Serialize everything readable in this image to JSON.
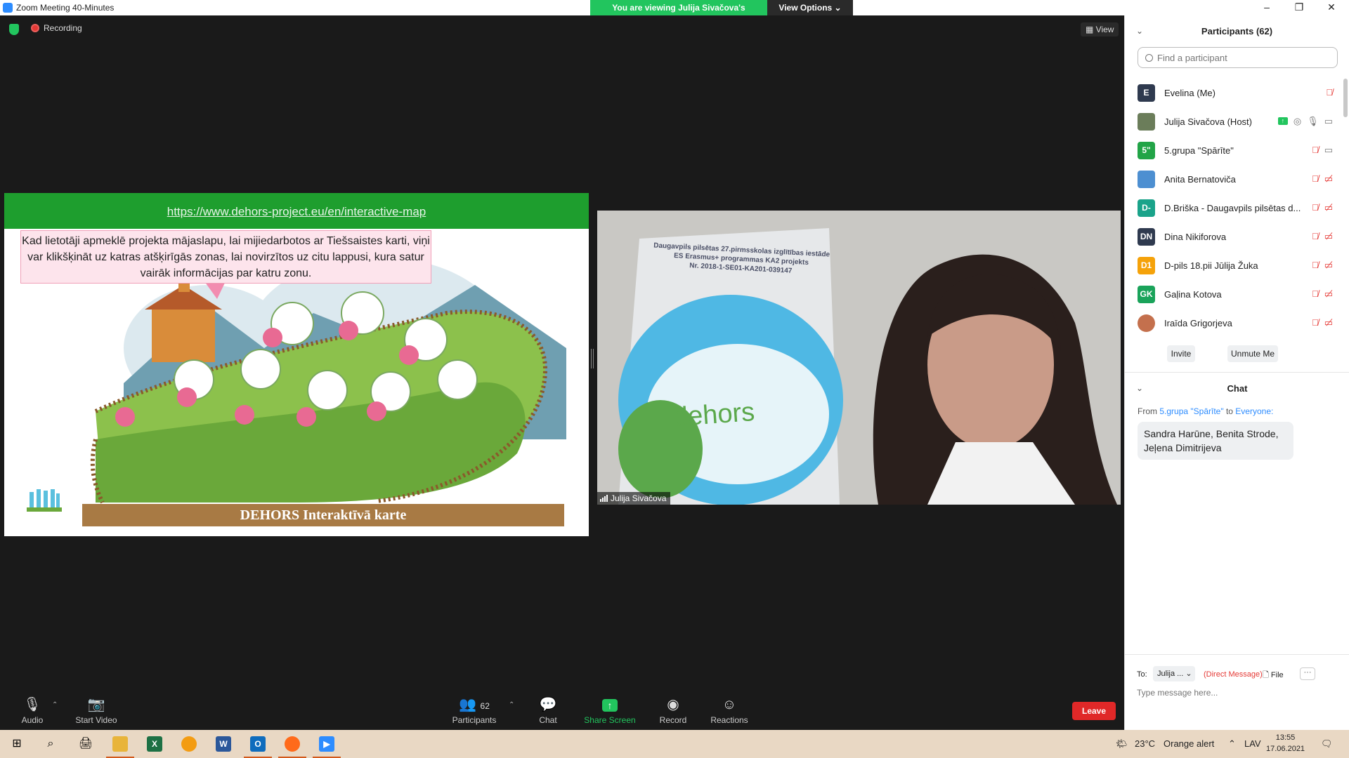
{
  "titlebar": {
    "title": "Zoom Meeting 40-Minutes",
    "minimize": "–",
    "maximize": "❐",
    "close": "✕"
  },
  "view_banner": {
    "message": "You are viewing Julija Sivačova's screen",
    "options": "View Options ⌄"
  },
  "meeting": {
    "recording_label": "Recording",
    "view_label": "▦ View"
  },
  "shared_screen": {
    "url": "https://www.dehors-project.eu/en/interactive-map",
    "callout": "Kad lietotāji apmeklē projekta mājaslapu, lai mijiedarbotos ar Tiešsaistes karti, viņi var klikšķināt uz katras atšķirīgās zonas, lai novirzītos uz citu lappusi, kura satur vairāk informācijas par katru zonu.",
    "banner": "DEHORS Interaktīvā karte"
  },
  "video": {
    "doc_lines": [
      "Daugavpils pilsētas 27.pirmsskolas izglītības iestāde",
      "ES Erasmus+ programmas KA2 projekts",
      "Nr. 2018-1-SE01-KA201-039147"
    ],
    "doc_logo": "dehors",
    "participant_name": "Julija Sivačova"
  },
  "toolbar": {
    "audio": "Audio",
    "start_video": "Start Video",
    "participants": "Participants",
    "participants_count": "62",
    "chat": "Chat",
    "share_screen": "Share Screen",
    "record": "Record",
    "reactions": "Reactions",
    "leave": "Leave"
  },
  "participants_panel": {
    "title": "Participants (62)",
    "search_placeholder": "Find a participant",
    "participants": [
      {
        "initials": "E",
        "name": "Evelina (Me)",
        "color": "#2f3a4f"
      },
      {
        "initials": "",
        "name": "Julija Sivačova (Host)",
        "color": "#6b7d5a"
      },
      {
        "initials": "5\"",
        "name": "5.grupa \"Spārīte\"",
        "color": "#22a447"
      },
      {
        "initials": "",
        "name": "Anita Bernatoviča",
        "color": "#4d8fd1"
      },
      {
        "initials": "D-",
        "name": "D.Briška - Daugavpils pilsētas d...",
        "color": "#1aa38a"
      },
      {
        "initials": "DN",
        "name": "Dina Nikiforova",
        "color": "#2f3a4f"
      },
      {
        "initials": "D1",
        "name": "D-pils 18.pii Jūlija Žuka",
        "color": "#f5a20a"
      },
      {
        "initials": "GK",
        "name": "Gaļina Kotova",
        "color": "#1aa35a"
      },
      {
        "initials": "",
        "name": "Iraīda Grigorjeva",
        "color": "#c4704d"
      }
    ],
    "invite": "Invite",
    "unmute_me": "Unmute Me"
  },
  "chat_panel": {
    "title": "Chat",
    "from_prefix": "From",
    "from_sender": "5.grupa \"Spārīte\"",
    "to_word": "to",
    "to_target": "Everyone:",
    "message": "Sandra Harūne, Benita Strode, Jeļena Dimitrijeva",
    "to_label": "To:",
    "to_select": "Julija ... ⌄",
    "direct_message": "(Direct Message)",
    "file": "File",
    "more": "···",
    "input_placeholder": "Type message here..."
  },
  "taskbar": {
    "weather": "23°C",
    "alert": "Orange alert",
    "lang": "LAV",
    "time": "13:55",
    "date": "17.06.2021"
  }
}
